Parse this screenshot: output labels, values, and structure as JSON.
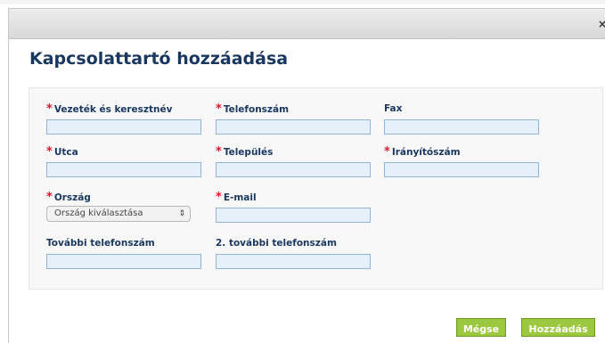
{
  "dialog": {
    "title": "Kapcsolattartó hozzáadása",
    "close_glyph": "×"
  },
  "form": {
    "required_marker": "*",
    "fields": {
      "last_first_name": {
        "label": "Vezeték és keresztnév",
        "value": "",
        "required": true
      },
      "phone": {
        "label": "Telefonszám",
        "value": "",
        "required": true
      },
      "fax": {
        "label": "Fax",
        "value": "",
        "required": false
      },
      "street": {
        "label": "Utca",
        "value": "",
        "required": true
      },
      "city": {
        "label": "Település",
        "value": "",
        "required": true
      },
      "zip": {
        "label": "Irányítószám",
        "value": "",
        "required": true
      },
      "country": {
        "label": "Ország",
        "selected": "Ország kiválasztása",
        "required": true
      },
      "email": {
        "label": "E-mail",
        "value": "",
        "required": true
      },
      "additional_phone": {
        "label": "További telefonszám",
        "value": "",
        "required": false
      },
      "additional_phone_2": {
        "label": "2. további telefonszám",
        "value": "",
        "required": false
      }
    }
  },
  "actions": {
    "cancel_label": "Mégse",
    "add_label": "Hozzáadás"
  },
  "colors": {
    "heading": "#19375f",
    "required": "#e0152b",
    "input_bg": "#e6f0fb",
    "input_border": "#8fb4de",
    "button": "#9bc83e"
  }
}
